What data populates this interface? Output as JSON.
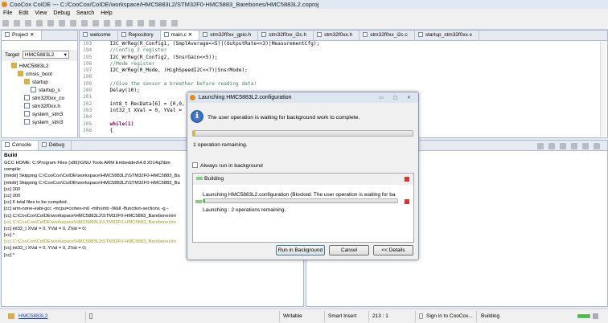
{
  "window": {
    "title": "CooCox CoIDE --- C:/CooCox/CoIDE/workspace/HMC5883L2/STM32F0-HMC5883_Barebones/HMC5883L2.coproj"
  },
  "menu": [
    "File",
    "Edit",
    "View",
    "Debug",
    "Search",
    "Help"
  ],
  "project": {
    "tab": "Project",
    "target_label": "Target",
    "target_value": "HMC5883L2",
    "tree": [
      {
        "label": "HMC5883L2",
        "depth": 0,
        "icon": "project-folder-icon"
      },
      {
        "label": "cmsis_boot",
        "depth": 1,
        "icon": "folder-icon"
      },
      {
        "label": "startup",
        "depth": 2,
        "icon": "folder-icon"
      },
      {
        "label": "startup_s",
        "depth": 3,
        "icon": "asm-file-icon"
      },
      {
        "label": "stm32f0xx_co",
        "depth": 2,
        "icon": "c-file-icon"
      },
      {
        "label": "stm32f0xx.h",
        "depth": 2,
        "icon": "h-file-icon"
      },
      {
        "label": "system_stm3",
        "depth": 2,
        "icon": "c-file-icon"
      },
      {
        "label": "system_stm3",
        "depth": 2,
        "icon": "c-file-icon"
      }
    ]
  },
  "editor": {
    "tabs": [
      "welcome",
      "Repository",
      "main.c",
      "stm32f0xx_gpio.h",
      "stm32f0xx_i2c.h",
      "stm32f0xx.h",
      "stm32f0xx_i2c.c",
      "startup_stm32f0xx.s"
    ],
    "active_tab": 2,
    "lines": [
      {
        "n": "193",
        "t": "    I2C_WrReg(R_Config1, (SmplAverage<<5)|(OutputRate<<3)|MeasurementCfg);",
        "c": ""
      },
      {
        "n": "194",
        "t": "    //Config 2 register",
        "c": "cm"
      },
      {
        "n": "195",
        "t": "    I2C_WrReg(R_Config2, (SnsrGain<<5));",
        "c": ""
      },
      {
        "n": "196",
        "t": "    //Mode register",
        "c": "cm"
      },
      {
        "n": "197",
        "t": "    I2C_WrReg(R_Mode, (HighSpeedI2C<<7)|SnsrMode);",
        "c": ""
      },
      {
        "n": "198",
        "t": "",
        "c": ""
      },
      {
        "n": "199",
        "t": "    //Give the sensor a breather before reading data!",
        "c": "cm"
      },
      {
        "n": "200",
        "t": "    Delay(10);",
        "c": ""
      },
      {
        "n": "201",
        "t": "",
        "c": ""
      },
      {
        "n": "202",
        "t": "    int8_t RecData[6] = {0,0,",
        "c": ""
      },
      {
        "n": "203",
        "t": "    int32_t XVal = 0, YVal =",
        "c": ""
      },
      {
        "n": "204",
        "t": "",
        "c": ""
      },
      {
        "n": "205",
        "t": "    while(1)",
        "c": "kw"
      },
      {
        "n": "206",
        "t": "    {",
        "c": ""
      }
    ]
  },
  "console": {
    "tabs": [
      "Console",
      "Debug"
    ],
    "header": "Build",
    "lines": [
      {
        "t": "GCC HOME: C:\\Program Files (x86)\\GNU Tools ARM Embedded\\4.8 2014q2\\bin",
        "c": ""
      },
      {
        "t": "compile:",
        "c": ""
      },
      {
        "t": "    [mkdir] Skipping C:\\CooCox\\CoIDE\\workspace\\HMC5883L2\\STM32F0-HMC5883_Ba",
        "c": ""
      },
      {
        "t": "    [mkdir] Skipping C:\\CooCox\\CoIDE\\workspace\\HMC5883L2\\STM32F0-HMC5883_Ba",
        "c": ""
      },
      {
        "t": "        [cc] 200",
        "c": ""
      },
      {
        "t": "        [cc] 200",
        "c": ""
      },
      {
        "t": "        [cc] 6 total files to be compiled.",
        "c": ""
      },
      {
        "t": "        [cc] arm-none-eabi-gcc -mcpu=cortex-m0 -mthumb -Wall -ffunction-sections -g -",
        "c": ""
      },
      {
        "t": "        [cc] C:\\CooCox\\CoIDE\\workspace\\HMC5883L2\\STM32F0-HMC5883_Barebones\\m",
        "c": ""
      },
      {
        "t": "        [cc] C:\\CooCox\\CoIDE\\workspace\\HMC5883L2\\STM32F0-HMC5883_Barebones\\m",
        "c": "y"
      },
      {
        "t": "        [cc]    int32_t XVal = 0, YVal = 0, ZVal = 0;",
        "c": ""
      },
      {
        "t": "        [cc]                                   ^",
        "c": ""
      },
      {
        "t": "        [cc] C:\\CooCox\\CoIDE\\workspace\\HMC5883L2\\STM32F0-HMC5883_Barebones\\m",
        "c": "y"
      },
      {
        "t": "        [cc]    int32_t XVal = 0, YVal = 0, ZVal = 0;",
        "c": ""
      },
      {
        "t": "        [cc]                        ^",
        "c": ""
      }
    ]
  },
  "dialog": {
    "title": "Launching HMC5883L2.configuration",
    "message": "The user operation is waiting for background work to complete.",
    "progress": 0.01,
    "remaining": "1 operation remaining.",
    "checkbox_label": "Always run in background",
    "checkbox_checked": false,
    "job_group": "Building",
    "job_title": "Launching HMC5883L2.configuration (Blocked: The user operation is waiting for ba",
    "job_progress": 0.01,
    "job_status": "Launching : 2 operations remaining.",
    "buttons": {
      "run_bg": "Run in Background",
      "cancel": "Cancel",
      "details": "<< Details"
    }
  },
  "status": {
    "project": "HMC5883L2",
    "writable": "Writable",
    "insert_mode": "Smart Insert",
    "position": "213 : 1",
    "signin": "Sign in to CooCox...",
    "activity": "Building"
  }
}
